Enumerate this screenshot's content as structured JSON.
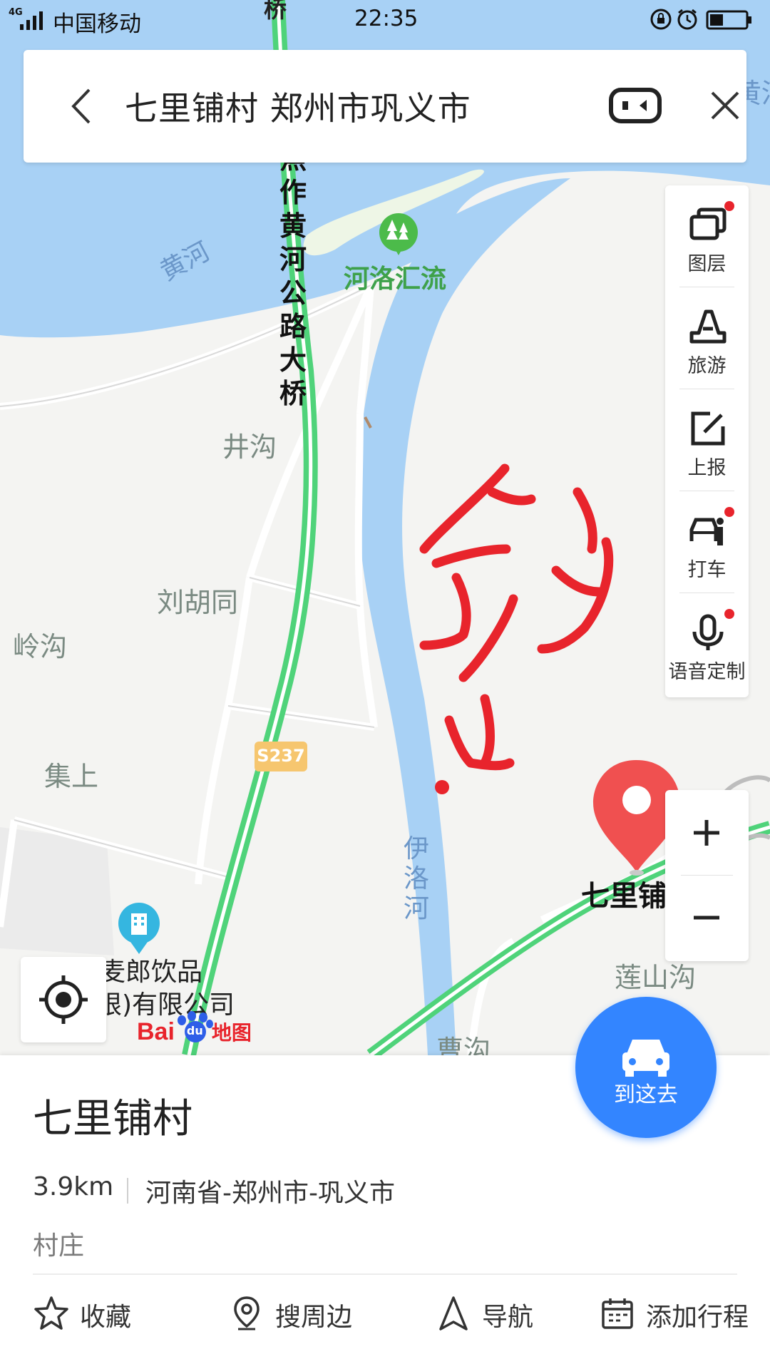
{
  "status_bar": {
    "network": "4G",
    "carrier": "中国移动",
    "time": "22:35"
  },
  "search": {
    "query": "七里铺村 郑州市巩义市"
  },
  "map": {
    "labels": {
      "bridge_top": "桥",
      "bridge_name": "焦作黄河公路大桥",
      "river_huanghe": "黄河",
      "river_huanghe_edge": "黄河",
      "poi_heluo": "河洛汇流",
      "jinggou": "井沟",
      "liuhutong": "刘胡同",
      "linggou": "岭沟",
      "jishang": "集上",
      "road_s237": "S237",
      "river_yiluo": "伊洛河",
      "poi_company_line1": "麦郎饮品",
      "poi_company_line2": "限)有限公司",
      "destination": "七里铺",
      "lianshangou": "莲山沟",
      "caogou": "曹沟",
      "logo_bai": "Bai",
      "logo_du": "du",
      "logo_ditu": "地图"
    },
    "colors": {
      "water": "#a8d1f5",
      "land": "#f4f4f2",
      "highway": "#4fd37a",
      "pin": "#f05050",
      "handwriting": "#e8242c"
    }
  },
  "toolbar": {
    "items": [
      {
        "label": "图层",
        "icon": "layers-icon",
        "badge": true
      },
      {
        "label": "旅游",
        "icon": "travel-icon",
        "badge": false
      },
      {
        "label": "上报",
        "icon": "report-icon",
        "badge": false
      },
      {
        "label": "打车",
        "icon": "taxi-icon",
        "badge": true
      },
      {
        "label": "语音定制",
        "icon": "voice-icon",
        "badge": true
      }
    ]
  },
  "zoom": {
    "in_icon": "plus-icon",
    "out_icon": "minus-icon"
  },
  "place": {
    "name": "七里铺村",
    "distance": "3.9km",
    "address": "河南省-郑州市-巩义市",
    "category": "村庄"
  },
  "go_button": {
    "label": "到这去"
  },
  "actions": [
    {
      "label": "收藏",
      "icon": "star-icon"
    },
    {
      "label": "搜周边",
      "icon": "nearby-pin-icon"
    },
    {
      "label": "导航",
      "icon": "navigate-icon"
    },
    {
      "label": "添加行程",
      "icon": "calendar-icon"
    }
  ]
}
